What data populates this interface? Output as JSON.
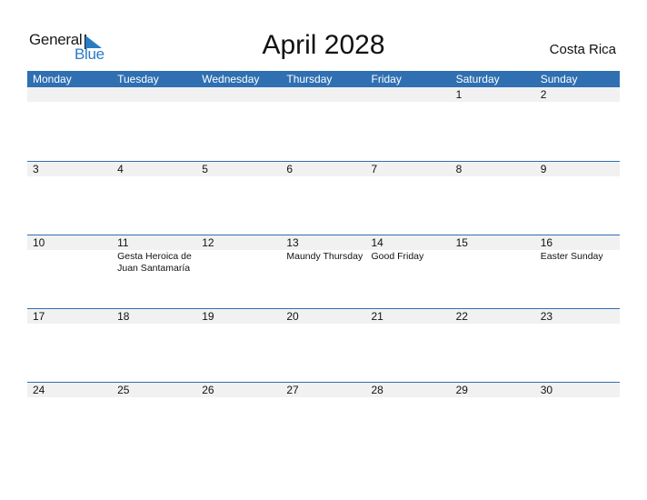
{
  "logo": {
    "word1": "General",
    "word2": "Blue"
  },
  "title": "April 2028",
  "country": "Costa Rica",
  "colors": {
    "header_bg": "#2f6fb2",
    "band_bg": "#f1f1f1",
    "logo_blue": "#2a7bc4"
  },
  "weekdays": [
    "Monday",
    "Tuesday",
    "Wednesday",
    "Thursday",
    "Friday",
    "Saturday",
    "Sunday"
  ],
  "weeks": [
    {
      "days": [
        "",
        "",
        "",
        "",
        "",
        "1",
        "2"
      ],
      "holidays": [
        "",
        "",
        "",
        "",
        "",
        "",
        ""
      ]
    },
    {
      "days": [
        "3",
        "4",
        "5",
        "6",
        "7",
        "8",
        "9"
      ],
      "holidays": [
        "",
        "",
        "",
        "",
        "",
        "",
        ""
      ]
    },
    {
      "days": [
        "10",
        "11",
        "12",
        "13",
        "14",
        "15",
        "16"
      ],
      "holidays": [
        "",
        "Gesta Heroica de Juan Santamaría",
        "",
        "Maundy Thursday",
        "Good Friday",
        "",
        "Easter Sunday"
      ]
    },
    {
      "days": [
        "17",
        "18",
        "19",
        "20",
        "21",
        "22",
        "23"
      ],
      "holidays": [
        "",
        "",
        "",
        "",
        "",
        "",
        ""
      ]
    },
    {
      "days": [
        "24",
        "25",
        "26",
        "27",
        "28",
        "29",
        "30"
      ],
      "holidays": [
        "",
        "",
        "",
        "",
        "",
        "",
        ""
      ]
    }
  ]
}
